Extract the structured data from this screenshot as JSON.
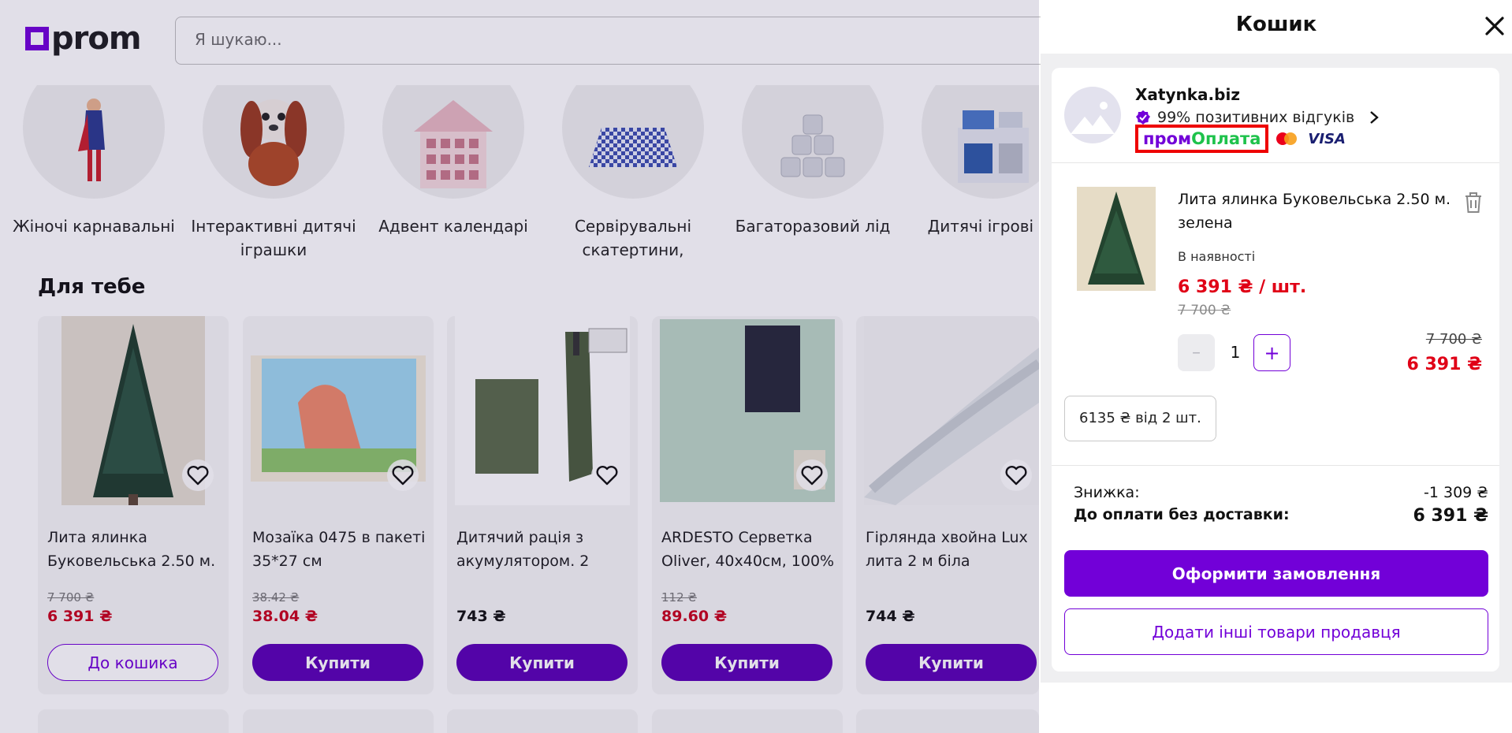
{
  "header": {
    "logo_text": "prom",
    "search_placeholder": "Я шукаю..."
  },
  "categories": [
    {
      "label": "Жіночі карнавальні"
    },
    {
      "label": "Інтерактивні дитячі іграшки"
    },
    {
      "label": "Адвент календарі"
    },
    {
      "label": "Сервірувальні скатертини,"
    },
    {
      "label": "Багаторазовий лід"
    },
    {
      "label": "Дитячі ігрові ку"
    }
  ],
  "section_title": "Для тебе",
  "products": [
    {
      "title": "Лита ялинка Буковельська 2.50 м.",
      "old_price": "7 700 ₴",
      "price": "6 391 ₴",
      "button": "До кошика"
    },
    {
      "title": "Мозаїка 0475 в пакеті 35*27 см",
      "old_price": "38.42 ₴",
      "price": "38.04 ₴",
      "button": "Купити"
    },
    {
      "title": "Дитячий рація з акумулятором. 2",
      "old_price": "",
      "price": "743 ₴",
      "button": "Купити"
    },
    {
      "title": "ARDESTO Серветка Oliver, 40x40см, 100%",
      "old_price": "112 ₴",
      "price": "89.60 ₴",
      "button": "Купити"
    },
    {
      "title": "Гірлянда хвойна Lux лита 2 м біла",
      "old_price": "",
      "price": "744 ₴",
      "button": "Купити"
    }
  ],
  "cart": {
    "title": "Кошик",
    "seller": {
      "name": "Xatynka.biz",
      "rating": "99% позитивних відгуків",
      "promo_prefix": "пром",
      "promo_suffix": "Оплата",
      "visa": "VISA"
    },
    "item": {
      "title": "Лита ялинка Буковельська 2.50 м. зелена",
      "availability": "В наявності",
      "unit_price": "6 391 ₴ / шт.",
      "unit_old_price": "7 700 ₴",
      "qty_minus": "–",
      "quantity": "1",
      "qty_plus": "+",
      "line_old_price": "7 700 ₴",
      "line_price": "6 391 ₴",
      "bulk_offer": "6135 ₴ від 2 шт."
    },
    "summary": {
      "discount_label": "Знижка:",
      "discount_value": "-1 309 ₴",
      "total_label": "До оплати без доставки:",
      "total_value": "6 391 ₴"
    },
    "checkout_button": "Оформити замовлення",
    "more_button": "Додати інші товари продавця"
  },
  "colors": {
    "brand": "#7200d8",
    "price_red": "#e00016",
    "button_dark": "#5a00b5"
  }
}
